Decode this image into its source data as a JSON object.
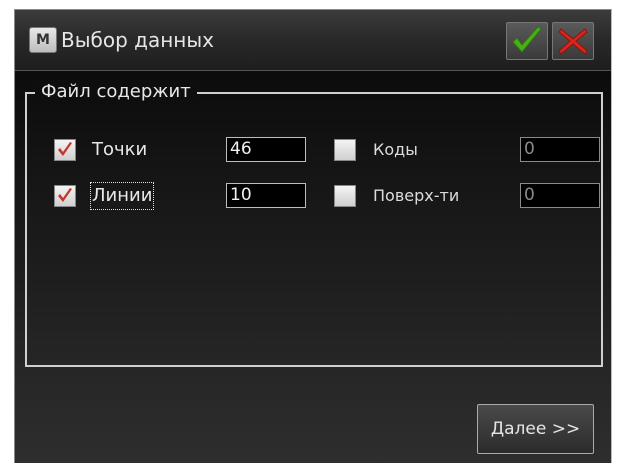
{
  "window": {
    "title": "Выбор данных",
    "app_icon_letter": "M",
    "icons": {
      "ok": "checkmark-icon",
      "close": "close-icon"
    },
    "colors": {
      "check": "#4caf1a",
      "close": "#d9261c",
      "checkbox_mark": "#c0392b"
    }
  },
  "group": {
    "legend": "Файл содержит",
    "rows": [
      {
        "left_label": "Точки",
        "left_checked": true,
        "left_value": "46",
        "right_label": "Коды",
        "right_checked": false,
        "right_value": "0"
      },
      {
        "left_label": "Линии",
        "left_checked": true,
        "left_value": "10",
        "right_label": "Поверх-ти",
        "right_checked": false,
        "right_value": "0"
      }
    ]
  },
  "footer": {
    "next_label": "Далее >>"
  }
}
